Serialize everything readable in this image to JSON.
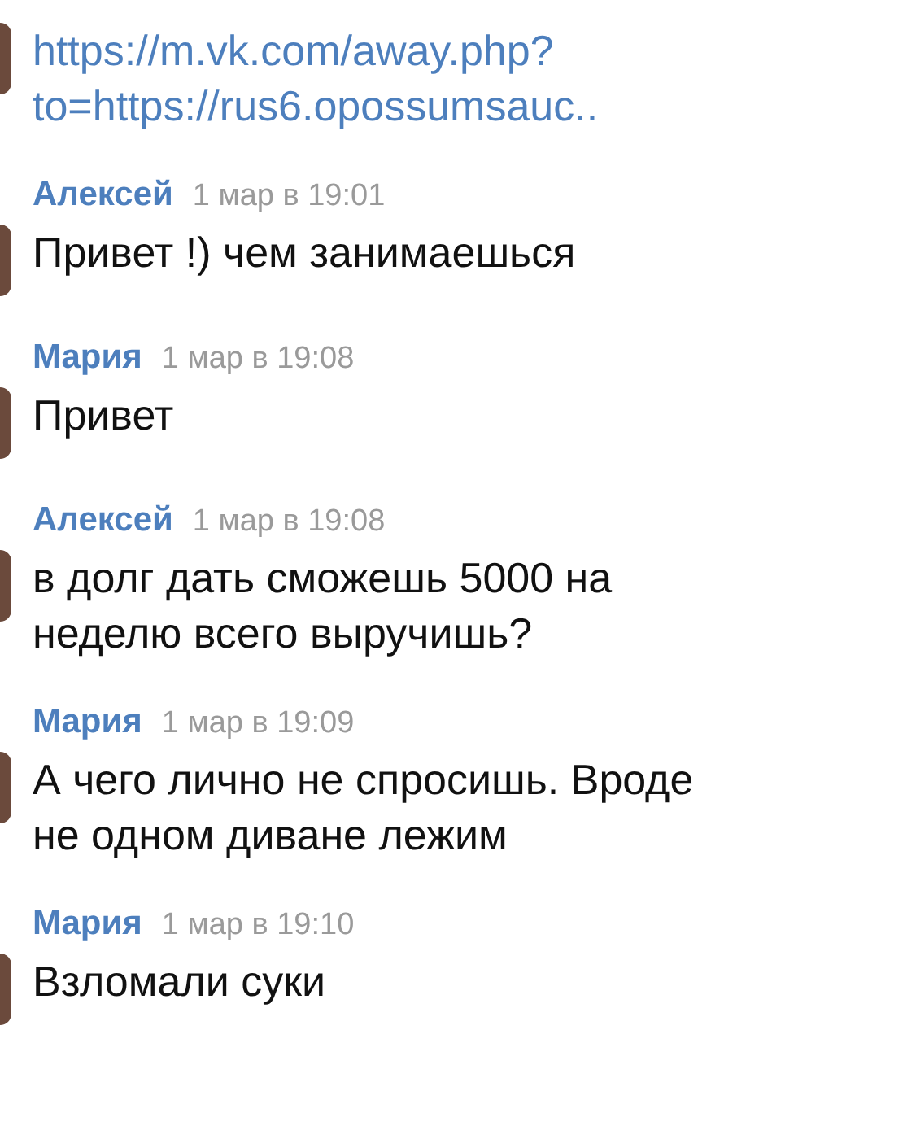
{
  "messages": [
    {
      "kind": "link",
      "text": "https://m.vk.com/away.php?\nto=https://rus6.opossumsauc.."
    },
    {
      "kind": "text",
      "author": "Алексей",
      "time": "1 мар в 19:01",
      "text": "Привет !) чем занимаешься"
    },
    {
      "kind": "text",
      "author": "Мария",
      "time": "1 мар в 19:08",
      "text": "Привет"
    },
    {
      "kind": "text",
      "author": "Алексей",
      "time": "1 мар в 19:08",
      "text": "в долг дать сможешь 5000 на\nнеделю всего выручишь?"
    },
    {
      "kind": "text",
      "author": "Мария",
      "time": "1 мар в 19:09",
      "text": "А чего лично не спросишь. Вроде\nне одном диване лежим"
    },
    {
      "kind": "text",
      "author": "Мария",
      "time": "1 мар в 19:10",
      "text": "Взломали суки"
    }
  ]
}
